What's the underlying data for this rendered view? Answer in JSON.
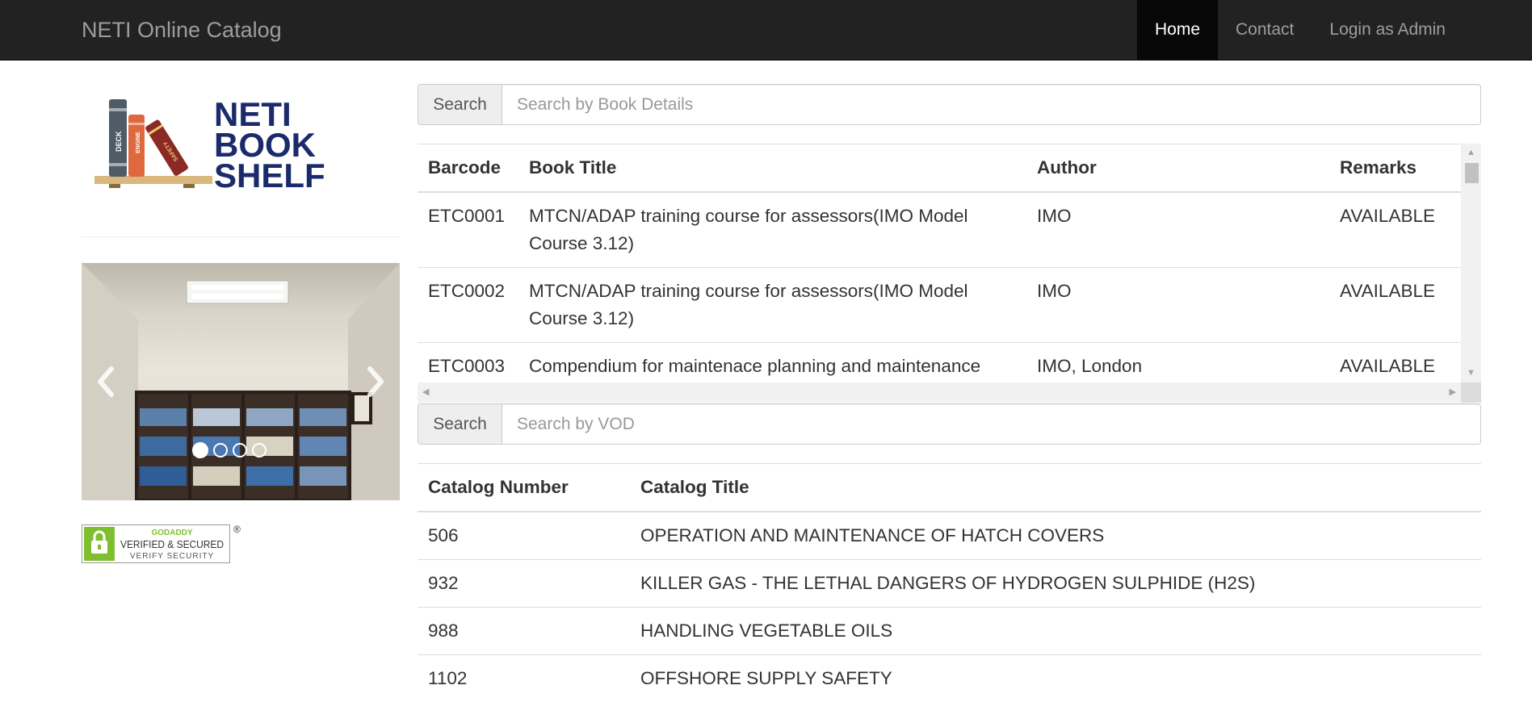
{
  "navbar": {
    "brand": "NETI Online Catalog",
    "items": [
      {
        "label": "Home",
        "active": true
      },
      {
        "label": "Contact",
        "active": false
      },
      {
        "label": "Login as Admin",
        "active": false
      }
    ]
  },
  "logo": {
    "line1": "NETI",
    "line2": "BOOK",
    "line3": "SHELF",
    "spines": [
      "DECK",
      "ENGINE",
      "SAFETY"
    ]
  },
  "carousel": {
    "prev_icon": "chevron-left-icon",
    "next_icon": "chevron-right-icon",
    "slide_count": 4,
    "active_index": 0
  },
  "seal": {
    "top": "GODADDY",
    "main": "VERIFIED & SECURED",
    "bottom": "VERIFY SECURITY",
    "mark": "®"
  },
  "book_search": {
    "button_label": "Search",
    "placeholder": "Search by Book Details"
  },
  "book_table": {
    "headers": [
      "Barcode",
      "Book Title",
      "Author",
      "Remarks"
    ],
    "rows": [
      {
        "barcode": "ETC0001",
        "title": "MTCN/ADAP training course for assessors(IMO Model Course 3.12)",
        "author": "IMO",
        "remarks": "AVAILABLE"
      },
      {
        "barcode": "ETC0002",
        "title": "MTCN/ADAP training course for assessors(IMO Model Course 3.12)",
        "author": "IMO",
        "remarks": "AVAILABLE"
      },
      {
        "barcode": "ETC0003",
        "title": "Compendium for maintenace planning and maintenance",
        "author": "IMO, London",
        "remarks": "AVAILABLE"
      }
    ]
  },
  "vod_search": {
    "button_label": "Search",
    "placeholder": "Search by VOD"
  },
  "vod_table": {
    "headers": [
      "Catalog Number",
      "Catalog Title"
    ],
    "rows": [
      {
        "number": "506",
        "title": "OPERATION AND MAINTENANCE OF HATCH COVERS"
      },
      {
        "number": "932",
        "title": "KILLER GAS - THE LETHAL DANGERS OF HYDROGEN SULPHIDE (H2S)"
      },
      {
        "number": "988",
        "title": "HANDLING VEGETABLE OILS"
      },
      {
        "number": "1102",
        "title": "OFFSHORE SUPPLY SAFETY"
      }
    ]
  }
}
